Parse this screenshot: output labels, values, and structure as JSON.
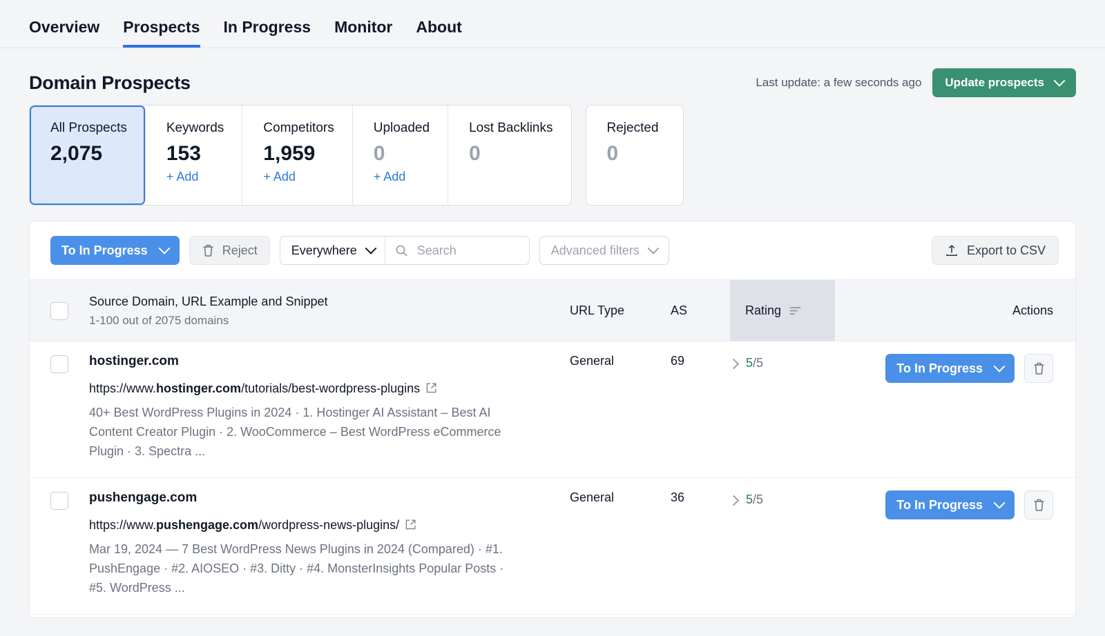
{
  "nav": {
    "tabs": [
      {
        "label": "Overview",
        "active": false
      },
      {
        "label": "Prospects",
        "active": true
      },
      {
        "label": "In Progress",
        "active": false
      },
      {
        "label": "Monitor",
        "active": false
      },
      {
        "label": "About",
        "active": false
      }
    ]
  },
  "header": {
    "title": "Domain Prospects",
    "last_update": "Last update: a few seconds ago",
    "update_button": "Update prospects"
  },
  "cards": {
    "grouped": [
      {
        "label": "All Prospects",
        "value": "2,075",
        "add": null,
        "selected": true,
        "zero": false
      },
      {
        "label": "Keywords",
        "value": "153",
        "add": "+ Add",
        "selected": false,
        "zero": false
      },
      {
        "label": "Competitors",
        "value": "1,959",
        "add": "+ Add",
        "selected": false,
        "zero": false
      },
      {
        "label": "Uploaded",
        "value": "0",
        "add": "+ Add",
        "selected": false,
        "zero": true
      },
      {
        "label": "Lost Backlinks",
        "value": "0",
        "add": null,
        "selected": false,
        "zero": true
      }
    ],
    "standalone": {
      "label": "Rejected",
      "value": "0",
      "zero": true
    }
  },
  "toolbar": {
    "to_in_progress": "To In Progress",
    "reject": "Reject",
    "scope": "Everywhere",
    "search_placeholder": "Search",
    "search_value": "",
    "advanced_filters": "Advanced filters",
    "export": "Export to CSV"
  },
  "table": {
    "headers": {
      "main_title": "Source Domain, URL Example and Snippet",
      "main_sub": "1-100 out of 2075 domains",
      "url_type": "URL Type",
      "as": "AS",
      "rating": "Rating",
      "actions": "Actions"
    },
    "rows": [
      {
        "domain": "hostinger.com",
        "url_prefix": "https://www.",
        "url_bold": "hostinger.com",
        "url_suffix": "/tutorials/best-wordpress-plugins",
        "snippet": "40+ Best WordPress Plugins in 2024 · 1. Hostinger AI Assistant – Best AI Content Creator Plugin · 2. WooCommerce – Best WordPress eCommerce Plugin · 3. Spectra ...",
        "url_type": "General",
        "as": "69",
        "rating_score": "5",
        "rating_total": "/5",
        "action_label": "To In Progress"
      },
      {
        "domain": "pushengage.com",
        "url_prefix": "https://www.",
        "url_bold": "pushengage.com",
        "url_suffix": "/wordpress-news-plugins/",
        "snippet": "Mar 19, 2024 — 7 Best WordPress News Plugins in 2024 (Compared) · #1. PushEngage · #2. AIOSEO · #3. Ditty · #4. MonsterInsights Popular Posts · #5. WordPress ...",
        "url_type": "General",
        "as": "36",
        "rating_score": "5",
        "rating_total": "/5",
        "action_label": "To In Progress"
      }
    ]
  },
  "colors": {
    "accent_blue": "#4a90e8",
    "nav_active": "#2e6fe0",
    "green": "#3a9172",
    "rating_green": "#2e7d54",
    "link_blue": "#2b7cdb",
    "page_bg": "#f4f5f7"
  },
  "icons": {
    "chevron_down": "chevron-down-icon",
    "trash": "trash-icon",
    "search": "search-icon",
    "export": "upload-icon",
    "external_link": "external-link-icon",
    "sort": "sort-icon"
  }
}
